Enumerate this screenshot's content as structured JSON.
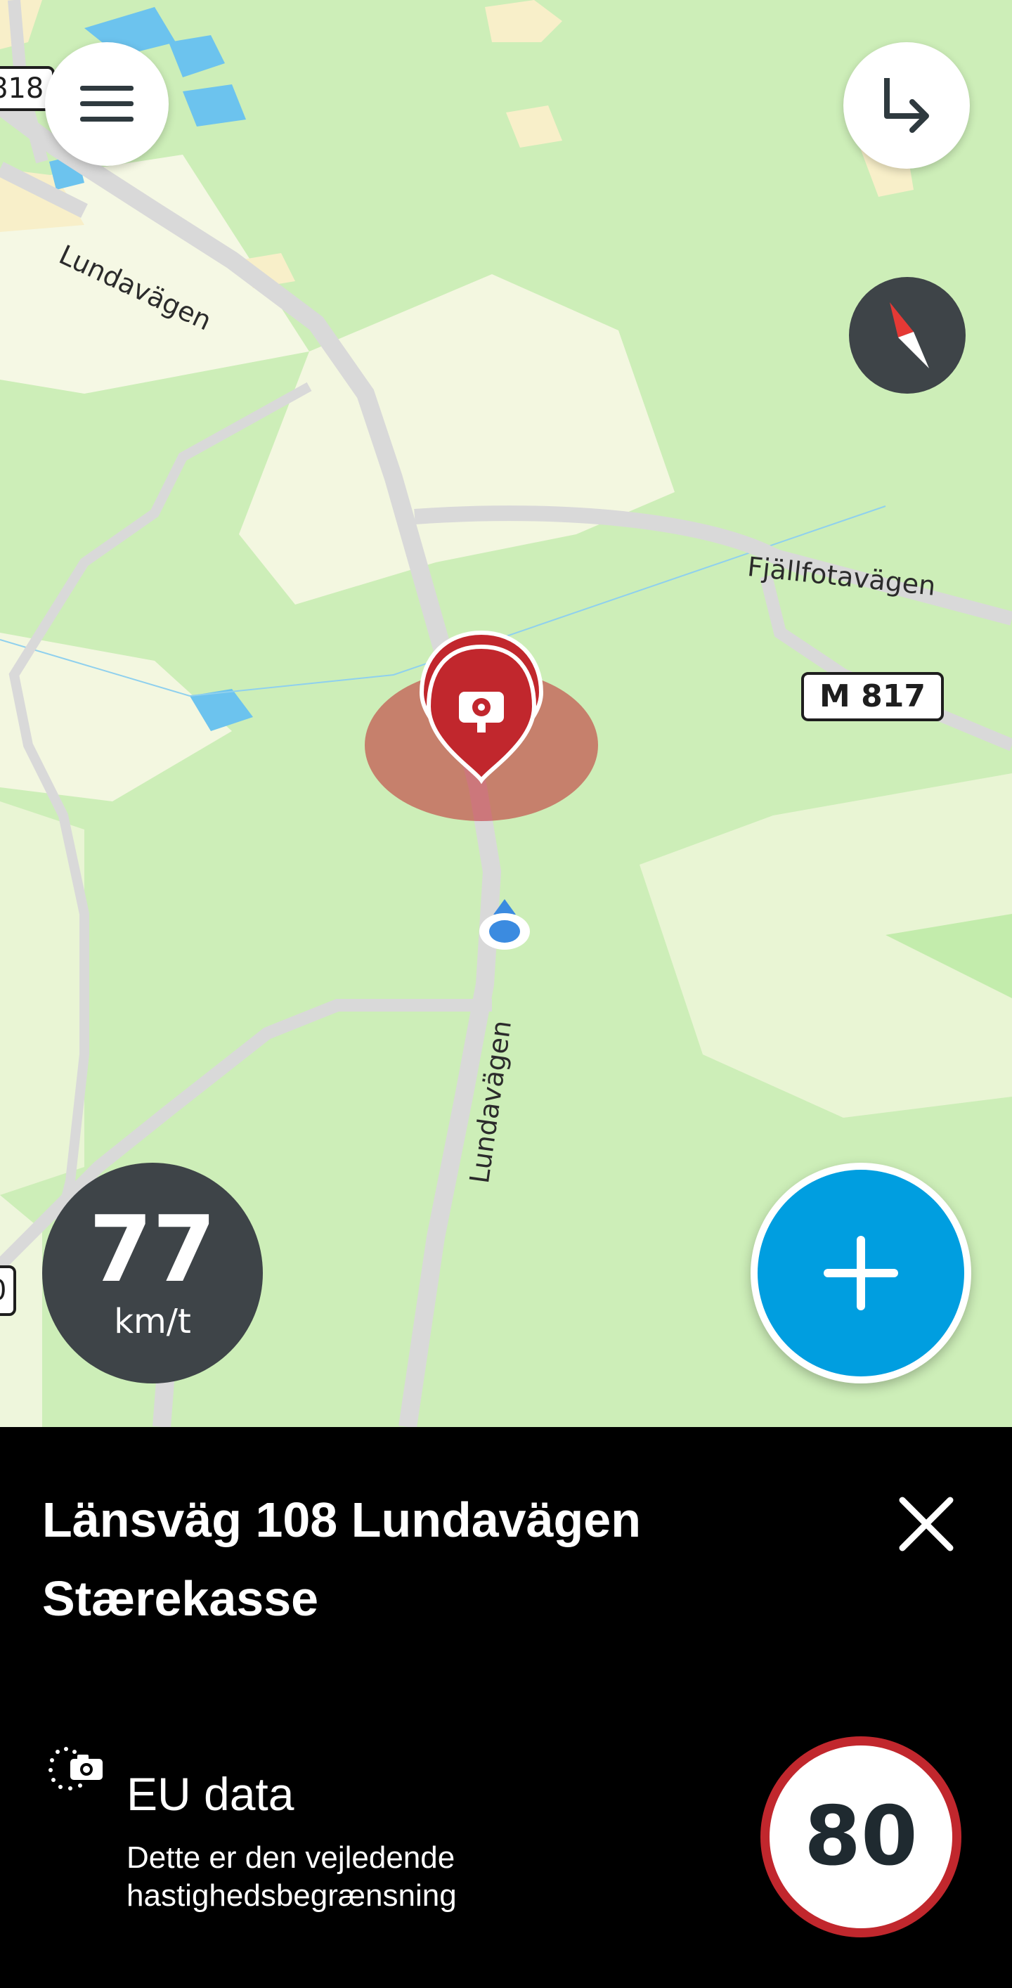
{
  "map": {
    "road_labels": {
      "lundavagen_north": "Lundavägen",
      "fjallfotavagen": "Fjällfotavägen",
      "lundavagen_south": "Lundavägen"
    },
    "shields": {
      "m817": "M 817",
      "left_top": "818",
      "left_bottom": "0"
    },
    "controls": {
      "menu_icon": "hamburger-menu-icon",
      "route_icon": "turn-right-arrow-icon",
      "compass_icon": "compass-icon",
      "add_icon": "plus-icon"
    },
    "speed": {
      "value": "77",
      "unit": "km/t"
    },
    "colors": {
      "accent_blue": "#009ee0",
      "camera_red": "#c1272d",
      "dark_badge": "#3e4448"
    }
  },
  "sheet": {
    "title_line1": "Länsväg 108 Lundavägen",
    "title_line2": "Stærekasse",
    "close_icon": "close-icon",
    "source_icon": "eu-camera-icon",
    "source_title": "EU data",
    "source_desc": "Dette er den vejledende hastighedsbegrænsning",
    "speed_limit": "80"
  }
}
